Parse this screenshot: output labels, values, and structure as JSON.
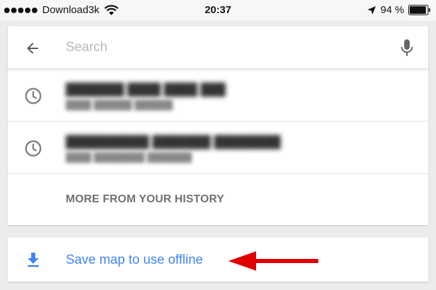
{
  "status_bar": {
    "carrier": "Download3k",
    "time": "20:37",
    "battery": "94 %",
    "signal_dots": 5,
    "battery_level": 0.94
  },
  "search": {
    "placeholder": "Search",
    "value": ""
  },
  "history": {
    "more_label": "MORE FROM YOUR HISTORY"
  },
  "offline": {
    "label": "Save map to use offline"
  },
  "colors": {
    "accent_blue": "#4285f4",
    "annotation_red": "#e00000",
    "icon_gray": "#777777"
  },
  "icons": [
    "wifi-icon",
    "location-arrow-icon",
    "battery-icon",
    "back-arrow-icon",
    "microphone-icon",
    "clock-icon",
    "download-icon"
  ]
}
